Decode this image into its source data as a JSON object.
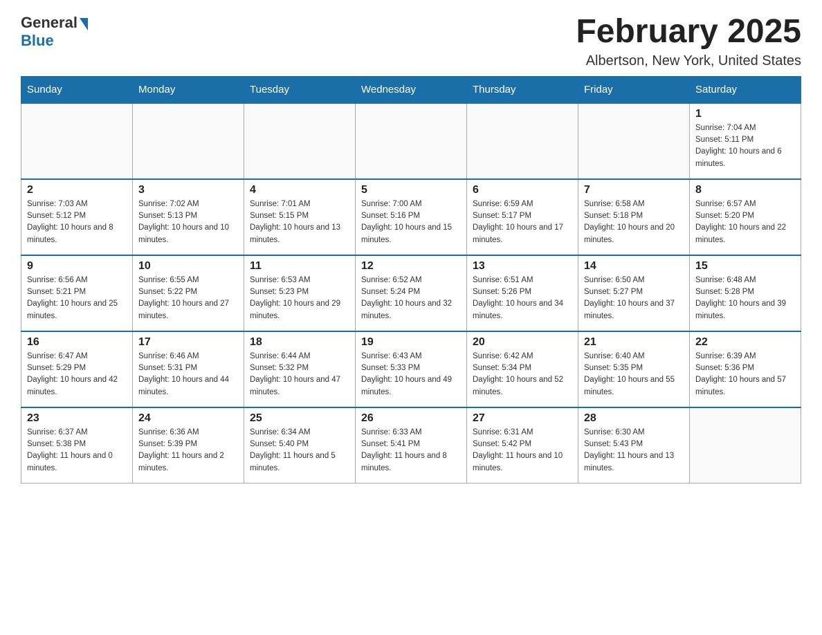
{
  "header": {
    "logo_general": "General",
    "logo_blue": "Blue",
    "month_title": "February 2025",
    "location": "Albertson, New York, United States"
  },
  "weekdays": [
    "Sunday",
    "Monday",
    "Tuesday",
    "Wednesday",
    "Thursday",
    "Friday",
    "Saturday"
  ],
  "weeks": [
    [
      {
        "day": "",
        "info": ""
      },
      {
        "day": "",
        "info": ""
      },
      {
        "day": "",
        "info": ""
      },
      {
        "day": "",
        "info": ""
      },
      {
        "day": "",
        "info": ""
      },
      {
        "day": "",
        "info": ""
      },
      {
        "day": "1",
        "info": "Sunrise: 7:04 AM\nSunset: 5:11 PM\nDaylight: 10 hours and 6 minutes."
      }
    ],
    [
      {
        "day": "2",
        "info": "Sunrise: 7:03 AM\nSunset: 5:12 PM\nDaylight: 10 hours and 8 minutes."
      },
      {
        "day": "3",
        "info": "Sunrise: 7:02 AM\nSunset: 5:13 PM\nDaylight: 10 hours and 10 minutes."
      },
      {
        "day": "4",
        "info": "Sunrise: 7:01 AM\nSunset: 5:15 PM\nDaylight: 10 hours and 13 minutes."
      },
      {
        "day": "5",
        "info": "Sunrise: 7:00 AM\nSunset: 5:16 PM\nDaylight: 10 hours and 15 minutes."
      },
      {
        "day": "6",
        "info": "Sunrise: 6:59 AM\nSunset: 5:17 PM\nDaylight: 10 hours and 17 minutes."
      },
      {
        "day": "7",
        "info": "Sunrise: 6:58 AM\nSunset: 5:18 PM\nDaylight: 10 hours and 20 minutes."
      },
      {
        "day": "8",
        "info": "Sunrise: 6:57 AM\nSunset: 5:20 PM\nDaylight: 10 hours and 22 minutes."
      }
    ],
    [
      {
        "day": "9",
        "info": "Sunrise: 6:56 AM\nSunset: 5:21 PM\nDaylight: 10 hours and 25 minutes."
      },
      {
        "day": "10",
        "info": "Sunrise: 6:55 AM\nSunset: 5:22 PM\nDaylight: 10 hours and 27 minutes."
      },
      {
        "day": "11",
        "info": "Sunrise: 6:53 AM\nSunset: 5:23 PM\nDaylight: 10 hours and 29 minutes."
      },
      {
        "day": "12",
        "info": "Sunrise: 6:52 AM\nSunset: 5:24 PM\nDaylight: 10 hours and 32 minutes."
      },
      {
        "day": "13",
        "info": "Sunrise: 6:51 AM\nSunset: 5:26 PM\nDaylight: 10 hours and 34 minutes."
      },
      {
        "day": "14",
        "info": "Sunrise: 6:50 AM\nSunset: 5:27 PM\nDaylight: 10 hours and 37 minutes."
      },
      {
        "day": "15",
        "info": "Sunrise: 6:48 AM\nSunset: 5:28 PM\nDaylight: 10 hours and 39 minutes."
      }
    ],
    [
      {
        "day": "16",
        "info": "Sunrise: 6:47 AM\nSunset: 5:29 PM\nDaylight: 10 hours and 42 minutes."
      },
      {
        "day": "17",
        "info": "Sunrise: 6:46 AM\nSunset: 5:31 PM\nDaylight: 10 hours and 44 minutes."
      },
      {
        "day": "18",
        "info": "Sunrise: 6:44 AM\nSunset: 5:32 PM\nDaylight: 10 hours and 47 minutes."
      },
      {
        "day": "19",
        "info": "Sunrise: 6:43 AM\nSunset: 5:33 PM\nDaylight: 10 hours and 49 minutes."
      },
      {
        "day": "20",
        "info": "Sunrise: 6:42 AM\nSunset: 5:34 PM\nDaylight: 10 hours and 52 minutes."
      },
      {
        "day": "21",
        "info": "Sunrise: 6:40 AM\nSunset: 5:35 PM\nDaylight: 10 hours and 55 minutes."
      },
      {
        "day": "22",
        "info": "Sunrise: 6:39 AM\nSunset: 5:36 PM\nDaylight: 10 hours and 57 minutes."
      }
    ],
    [
      {
        "day": "23",
        "info": "Sunrise: 6:37 AM\nSunset: 5:38 PM\nDaylight: 11 hours and 0 minutes."
      },
      {
        "day": "24",
        "info": "Sunrise: 6:36 AM\nSunset: 5:39 PM\nDaylight: 11 hours and 2 minutes."
      },
      {
        "day": "25",
        "info": "Sunrise: 6:34 AM\nSunset: 5:40 PM\nDaylight: 11 hours and 5 minutes."
      },
      {
        "day": "26",
        "info": "Sunrise: 6:33 AM\nSunset: 5:41 PM\nDaylight: 11 hours and 8 minutes."
      },
      {
        "day": "27",
        "info": "Sunrise: 6:31 AM\nSunset: 5:42 PM\nDaylight: 11 hours and 10 minutes."
      },
      {
        "day": "28",
        "info": "Sunrise: 6:30 AM\nSunset: 5:43 PM\nDaylight: 11 hours and 13 minutes."
      },
      {
        "day": "",
        "info": ""
      }
    ]
  ]
}
